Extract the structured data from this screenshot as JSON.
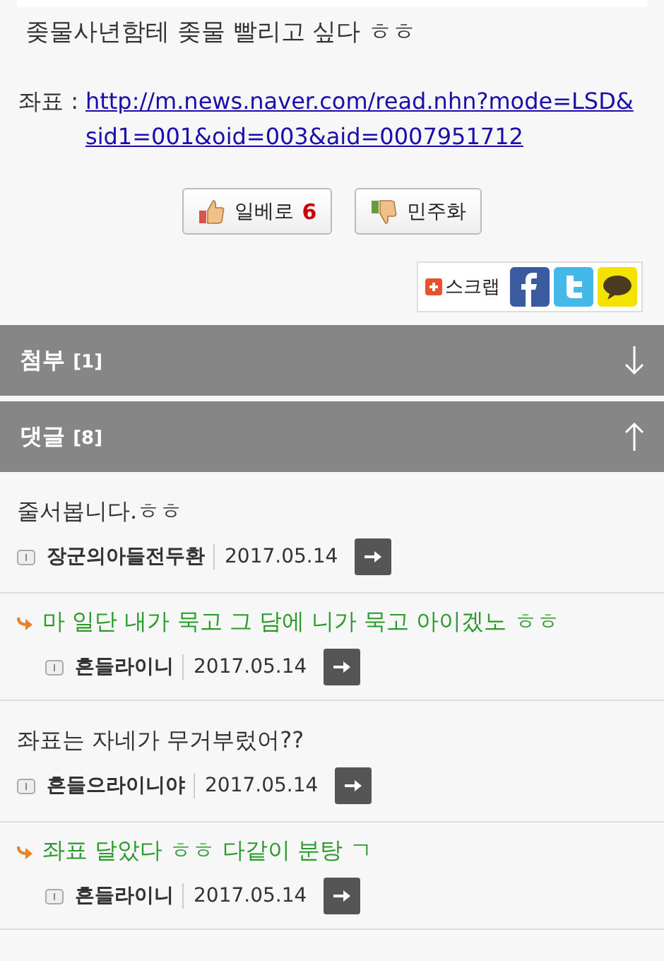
{
  "post": {
    "body": "좆물사년함테 좆물 빨리고 싶다 ㅎㅎ",
    "source_label": "좌표 :",
    "source_link": "http://m.news.naver.com/read.nhn?mode=LSD&sid1=001&oid=003&aid=0007951712"
  },
  "votes": [
    {
      "kind": "up",
      "label": "일베로",
      "count": "6"
    },
    {
      "kind": "down",
      "label": "민주화"
    }
  ],
  "share": {
    "label": "스크랩",
    "services": [
      {
        "kind": "facebook"
      },
      {
        "kind": "twitter"
      },
      {
        "kind": "kakao"
      }
    ]
  },
  "sections": [
    {
      "title": "첨부",
      "count": "[1]",
      "expanded": false
    },
    {
      "title": "댓글",
      "count": "[8]",
      "expanded": true
    }
  ],
  "comments": [
    {
      "kind": "comment",
      "text": "줄서봅니다.ㅎㅎ",
      "author": "장군의아들전두환",
      "date": "2017.05.14"
    },
    {
      "kind": "reply",
      "text": "마 일단 내가 묵고 그 담에 니가 묵고 아이겠노 ㅎㅎ",
      "author": "흔들라이니",
      "date": "2017.05.14"
    },
    {
      "kind": "comment",
      "text": "좌표는 자네가 무거부렀어??",
      "author": "흔들으라이니야",
      "date": "2017.05.14"
    },
    {
      "kind": "reply",
      "text": "좌표 달았다 ㅎㅎ 다같이 분탕 ㄱ",
      "author": "흔들라이니",
      "date": "2017.05.14"
    }
  ]
}
